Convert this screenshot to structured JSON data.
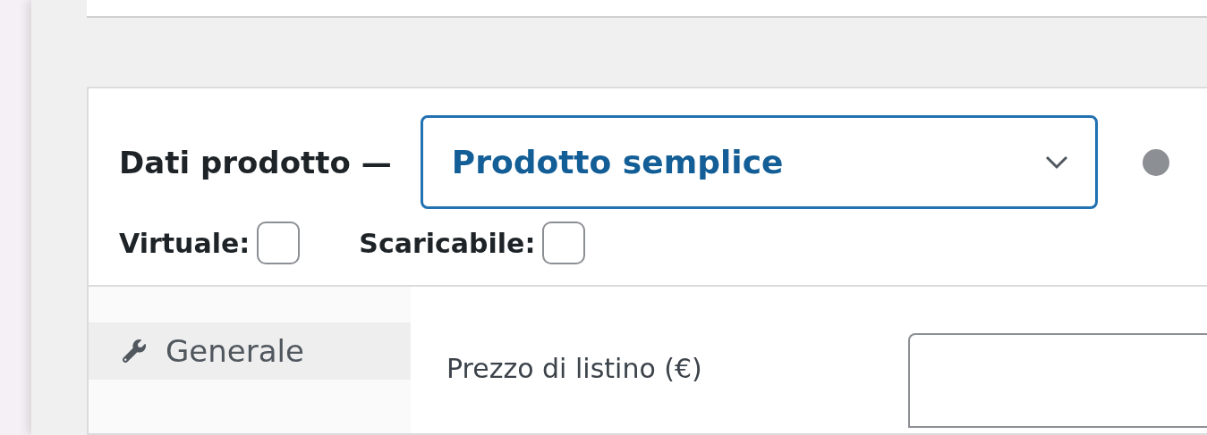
{
  "panel": {
    "title": "Dati prodotto —",
    "product_type": {
      "value": "Prodotto semplice"
    },
    "options": [
      {
        "label": "Virtuale:",
        "checked": false
      },
      {
        "label": "Scaricabile:",
        "checked": false
      }
    ]
  },
  "tabs": [
    {
      "label": "Generale",
      "selected": true
    }
  ],
  "fields": [
    {
      "label": "Prezzo di listino (€)"
    }
  ]
}
